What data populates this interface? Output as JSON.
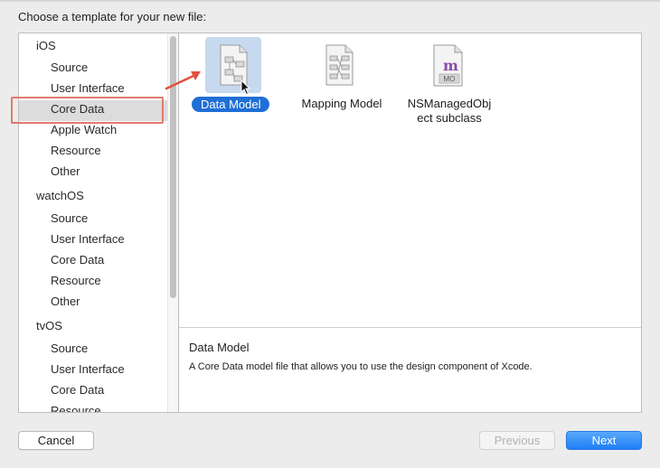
{
  "prompt": "Choose a template for your new file:",
  "sidebar": {
    "platforms": [
      {
        "name": "iOS",
        "items": [
          "Source",
          "User Interface",
          "Core Data",
          "Apple Watch",
          "Resource",
          "Other"
        ]
      },
      {
        "name": "watchOS",
        "items": [
          "Source",
          "User Interface",
          "Core Data",
          "Resource",
          "Other"
        ]
      },
      {
        "name": "tvOS",
        "items": [
          "Source",
          "User Interface",
          "Core Data",
          "Resource"
        ]
      }
    ],
    "selected": "Core Data"
  },
  "templates": [
    {
      "label": "Data Model",
      "icon": "data-model-icon",
      "selected": true
    },
    {
      "label": "Mapping Model",
      "icon": "mapping-model-icon",
      "selected": false
    },
    {
      "label": "NSManagedObj\nect subclass",
      "label_line1": "NSManagedObj",
      "label_line2": "ect subclass",
      "icon": "managed-object-icon",
      "icon_text": "MO",
      "selected": false
    }
  ],
  "description": {
    "title": "Data Model",
    "text": "A Core Data model file that allows you to use the design component of Xcode."
  },
  "buttons": {
    "cancel": "Cancel",
    "previous": "Previous",
    "next": "Next"
  },
  "colors": {
    "accent": "#1f6fd6",
    "highlight_annotation": "#e07a6b",
    "selection_bg": "#c7d9ef"
  }
}
